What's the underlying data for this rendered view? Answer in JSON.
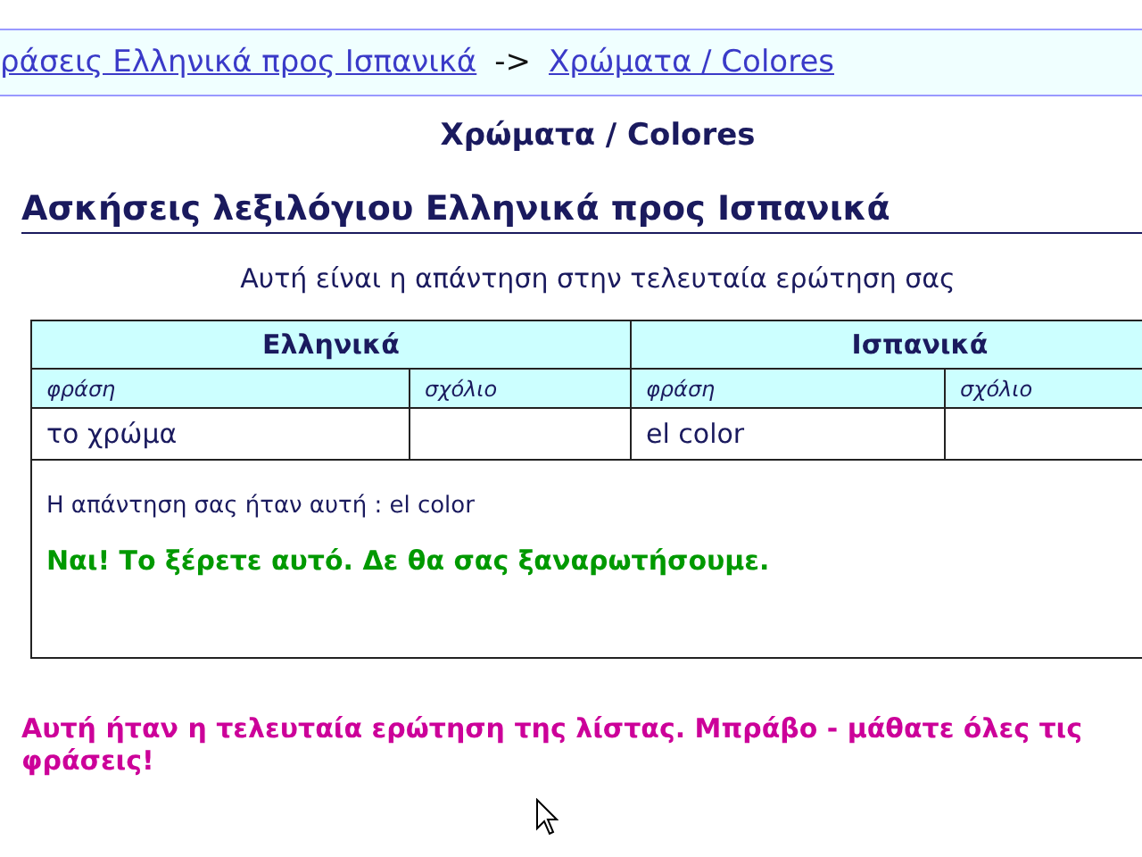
{
  "breadcrumb": {
    "links": [
      "ράσεις Ελληνικά προς Ισπανικά",
      "Χρώματα / Colores"
    ],
    "separator": "->"
  },
  "title": "Χρώματα / Colores",
  "heading": "Ασκήσεις λεξιλόγιου Ελληνικά προς Ισπανικά",
  "subtitle": "Αυτή είναι η απάντηση στην τελευταία ερώτηση σας",
  "table": {
    "groups": [
      "Ελληνικά",
      "Ισπανικά"
    ],
    "columns": [
      "φράση",
      "σχόλιο",
      "φράση",
      "σχόλιο"
    ],
    "row": [
      {
        "phrase": "το χρώμα"
      },
      {
        "phrase": "el color"
      }
    ],
    "answer": "Η απάντηση σας ήταν αυτή : el color",
    "verdict": "Ναι! Το ξέρετε αυτό. Δε θα σας ξαναρωτήσουμε."
  },
  "final_message": "Αυτή ήταν η τελευταία ερώτηση της λίστας. Μπράβο - μάθατε όλες τις φράσεις!"
}
